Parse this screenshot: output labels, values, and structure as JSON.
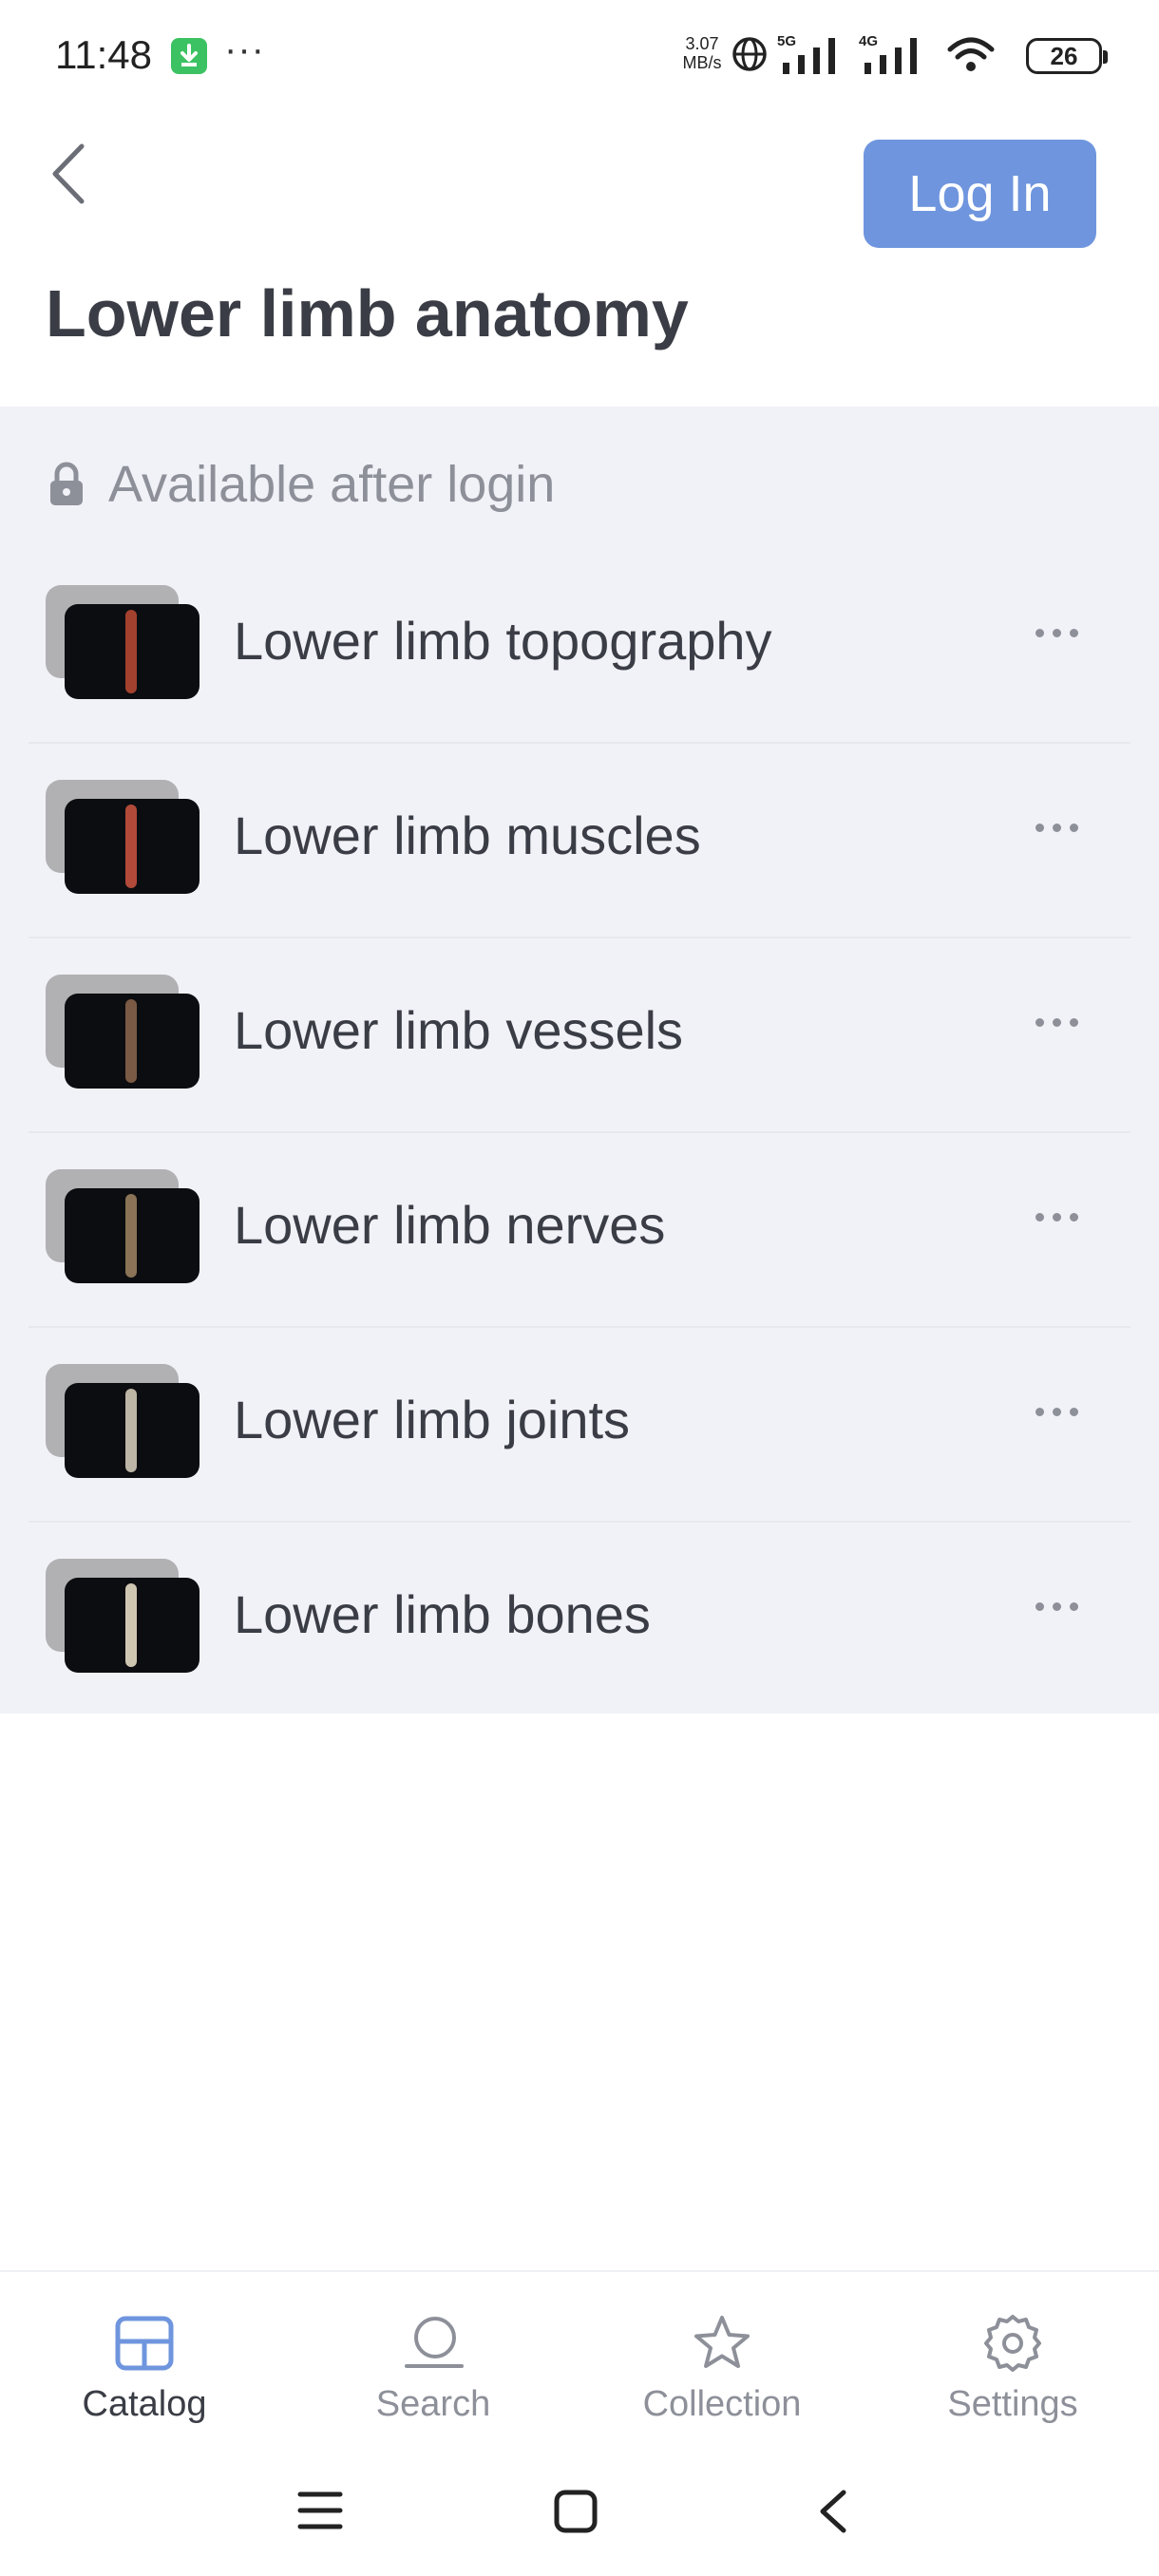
{
  "status_bar": {
    "time": "11:48",
    "dots": "···",
    "speed_value": "3.07",
    "speed_unit": "MB/s",
    "net1": "5G",
    "net2": "4G",
    "battery": "26"
  },
  "header": {
    "login_label": "Log In",
    "title": "Lower limb anatomy"
  },
  "section": {
    "lock_text": "Available after login",
    "items": [
      {
        "label": "Lower limb topography",
        "limb_color": "#a3412f"
      },
      {
        "label": "Lower limb muscles",
        "limb_color": "#b24a3a"
      },
      {
        "label": "Lower limb vessels",
        "limb_color": "#7a5a44"
      },
      {
        "label": "Lower limb nerves",
        "limb_color": "#8a7356"
      },
      {
        "label": "Lower limb joints",
        "limb_color": "#bdb6a7"
      },
      {
        "label": "Lower limb bones",
        "limb_color": "#cfc6b2"
      }
    ]
  },
  "nav": {
    "items": [
      {
        "label": "Catalog",
        "icon": "grid-icon",
        "active": true
      },
      {
        "label": "Search",
        "icon": "search-icon",
        "active": false
      },
      {
        "label": "Collection",
        "icon": "star-icon",
        "active": false
      },
      {
        "label": "Settings",
        "icon": "gear-icon",
        "active": false
      }
    ]
  },
  "colors": {
    "accent": "#6f95de",
    "list_bg": "#f1f2f7",
    "text": "#3a3d45",
    "muted": "#8d9099"
  }
}
